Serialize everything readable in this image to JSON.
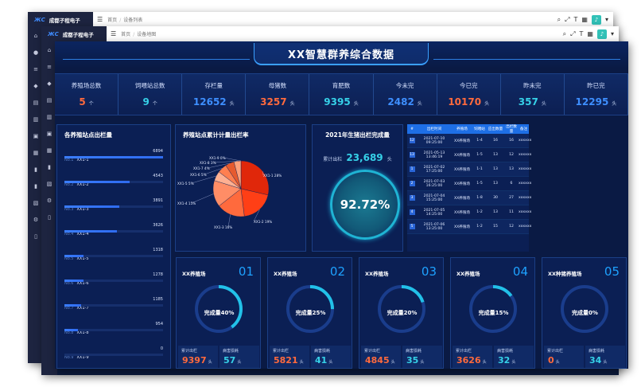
{
  "app": {
    "logo": "ЖС",
    "brand": "成都子程电子",
    "breadcrumb_home": "首页",
    "breadcrumb_current": "设备列表",
    "breadcrumb_current2": "设备地图"
  },
  "dashboard": {
    "title": "XX智慧群养综合数据",
    "kpis": [
      {
        "label": "养殖场总数",
        "value": "5",
        "unit": "个",
        "color": "#ff6a3d"
      },
      {
        "label": "饲喂站总数",
        "value": "9",
        "unit": "个",
        "color": "#36d1e8"
      },
      {
        "label": "存栏量",
        "value": "12652",
        "unit": "头",
        "color": "#3e8fff"
      },
      {
        "label": "母猪数",
        "value": "3257",
        "unit": "头",
        "color": "#ff6a3d"
      },
      {
        "label": "育肥数",
        "value": "9395",
        "unit": "头",
        "color": "#36d1e8"
      },
      {
        "label": "今未完",
        "value": "2482",
        "unit": "头",
        "color": "#3e8fff"
      },
      {
        "label": "今已完",
        "value": "10170",
        "unit": "头",
        "color": "#ff6a3d"
      },
      {
        "label": "昨未完",
        "value": "357",
        "unit": "头",
        "color": "#36d1e8"
      },
      {
        "label": "昨已完",
        "value": "12295",
        "unit": "头",
        "color": "#3e8fff"
      }
    ],
    "stations": {
      "title": "各养殖站点出栏量",
      "items": [
        {
          "no": "No.1",
          "name": "XX1-1",
          "value": "6894",
          "frac": 1.0
        },
        {
          "no": "No.2",
          "name": "XX1-2",
          "value": "4543",
          "frac": 0.66
        },
        {
          "no": "No.3",
          "name": "XX1-3",
          "value": "3891",
          "frac": 0.56
        },
        {
          "no": "No.4",
          "name": "XX1-4",
          "value": "3626",
          "frac": 0.53
        },
        {
          "no": "No.5",
          "name": "XX1-5",
          "value": "1318",
          "frac": 0.19
        },
        {
          "no": "No.6",
          "name": "XX1-6",
          "value": "1278",
          "frac": 0.19
        },
        {
          "no": "No.7",
          "name": "XX1-7",
          "value": "1185",
          "frac": 0.17
        },
        {
          "no": "No.8",
          "name": "XX1-8",
          "value": "954",
          "frac": 0.14
        },
        {
          "no": "No.9",
          "name": "XX1-9",
          "value": "0",
          "frac": 0.0
        }
      ]
    },
    "pie": {
      "title": "养殖站点累计计量出栏率"
    },
    "completion": {
      "title": "2021年生猪出栏完成量",
      "label": "累计出栏",
      "value": "23,689",
      "unit": "头",
      "percent": "92.72%"
    },
    "table": {
      "headers": [
        "#",
        "出栏时间",
        "养殖场",
        "饲喂站",
        "应出数量",
        "出栏数量",
        "备注"
      ],
      "rows": [
        [
          "12",
          "2021-07-10 09:25:00",
          "XX养殖场",
          "1-4",
          "16",
          "16",
          "xxxxxx"
        ],
        [
          "13",
          "2021-05-13 13:46:19",
          "XX养殖场",
          "1-5",
          "13",
          "12",
          "xxxxxx"
        ],
        [
          "1",
          "2021-07-02 17:25:00",
          "XX养殖场",
          "1-1",
          "13",
          "13",
          "xxxxxx"
        ],
        [
          "2",
          "2021-07-03 16:25:00",
          "XX养殖场",
          "1-5",
          "13",
          "6",
          "xxxxxx"
        ],
        [
          "3",
          "2021-07-04 15:25:00",
          "XX养殖场",
          "1-8",
          "30",
          "27",
          "xxxxxx"
        ],
        [
          "4",
          "2021-07-05 14:25:00",
          "XX养殖场",
          "1-2",
          "13",
          "11",
          "xxxxxx"
        ],
        [
          "5",
          "2021-07-06 13:25:00",
          "XX养殖场",
          "1-2",
          "15",
          "12",
          "xxxxxx"
        ]
      ]
    },
    "farms": [
      {
        "name": "XX养殖场",
        "num": "01",
        "label": "完成量40%",
        "pct": 0.4,
        "s1_label": "累计出栏",
        "s1_value": "9397",
        "s1_unit": "头",
        "s2_label": "病害损耗",
        "s2_value": "57",
        "s2_unit": "头"
      },
      {
        "name": "XX养殖场",
        "num": "02",
        "label": "完成量25%",
        "pct": 0.25,
        "s1_label": "累计出栏",
        "s1_value": "5821",
        "s1_unit": "头",
        "s2_label": "病害损耗",
        "s2_value": "41",
        "s2_unit": "头"
      },
      {
        "name": "XX养殖场",
        "num": "03",
        "label": "完成量20%",
        "pct": 0.2,
        "s1_label": "累计出栏",
        "s1_value": "4845",
        "s1_unit": "头",
        "s2_label": "病害损耗",
        "s2_value": "35",
        "s2_unit": "头"
      },
      {
        "name": "XX养殖场",
        "num": "04",
        "label": "完成量15%",
        "pct": 0.15,
        "s1_label": "累计出栏",
        "s1_value": "3626",
        "s1_unit": "头",
        "s2_label": "病害损耗",
        "s2_value": "32",
        "s2_unit": "头"
      },
      {
        "name": "XX种猪养殖场",
        "num": "05",
        "label": "完成量0%",
        "pct": 0.0,
        "s1_label": "累计出栏",
        "s1_value": "0",
        "s1_unit": "头",
        "s2_label": "病害损耗",
        "s2_value": "34",
        "s2_unit": "头"
      }
    ]
  },
  "chart_data": {
    "type": "pie",
    "title": "养殖站点累计计量出栏率",
    "categories": [
      "XX1-1",
      "XX1-2",
      "XX1-3",
      "XX1-4",
      "XX1-5",
      "XX1-6",
      "XX1-7",
      "XX1-8",
      "XX1-9"
    ],
    "values": [
      28,
      19,
      16,
      15,
      5.5,
      5.3,
      5,
      4,
      0
    ],
    "labels": [
      "XX1-1 28%",
      "XX1-2 19%",
      "XX1-3 16%",
      "XX1-4 15%",
      "XX1-5 5%",
      "XX1-6 5%",
      "XX1-7 4%",
      "XX1-8 3%",
      "XX1-9 0%"
    ],
    "colors": [
      "#e0270a",
      "#ff3f16",
      "#ff6a3d",
      "#ff8d66",
      "#ffb092",
      "#ff7f50",
      "#e65a2e",
      "#ffa07a",
      "#ffc8b0"
    ]
  }
}
